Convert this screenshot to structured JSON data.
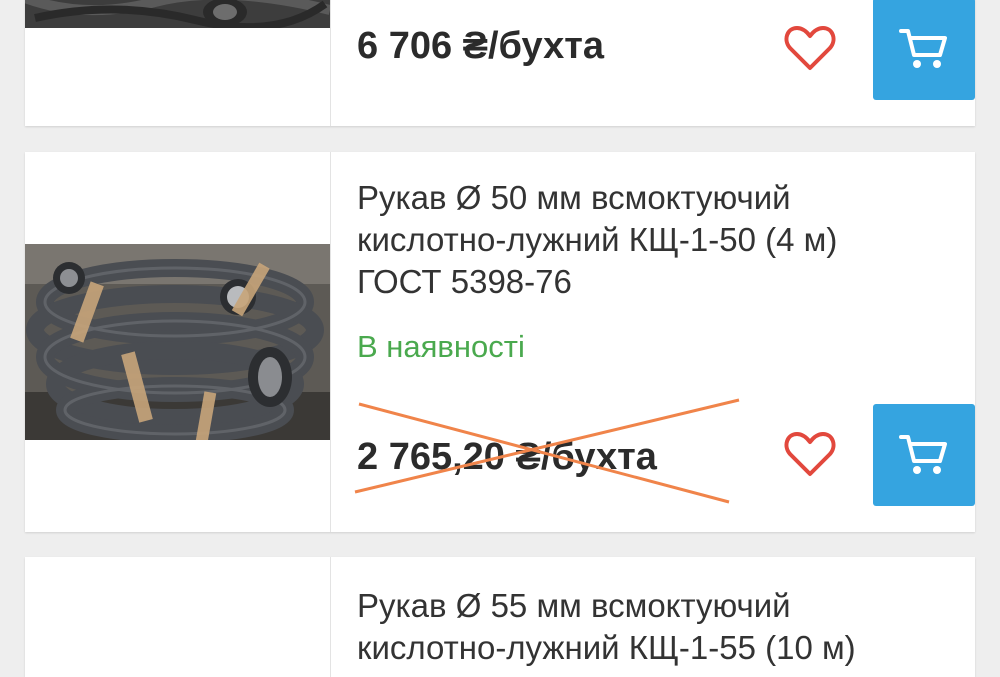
{
  "theme": {
    "cart_button_color": "#35a4e0",
    "heart_color": "#e2483d",
    "stock_color": "#4aa94e",
    "strike_color": "#f0844a"
  },
  "products": [
    {
      "title": "",
      "price": "6 706 ₴/бухта",
      "price_struck": false
    },
    {
      "title": "Рукав Ø 50 мм всмоктуючий кислотно-лужний КЩ-1-50 (4 м) ГОСТ 5398-76",
      "stock": "В наявності",
      "price": "2 765,20 ₴/бухта",
      "price_struck": true
    },
    {
      "title": "Рукав Ø 55 мм всмоктуючий кислотно-лужний КЩ-1-55 (10 м)"
    }
  ],
  "icons": {
    "favorite": "heart-icon",
    "cart": "shopping-cart-icon"
  }
}
